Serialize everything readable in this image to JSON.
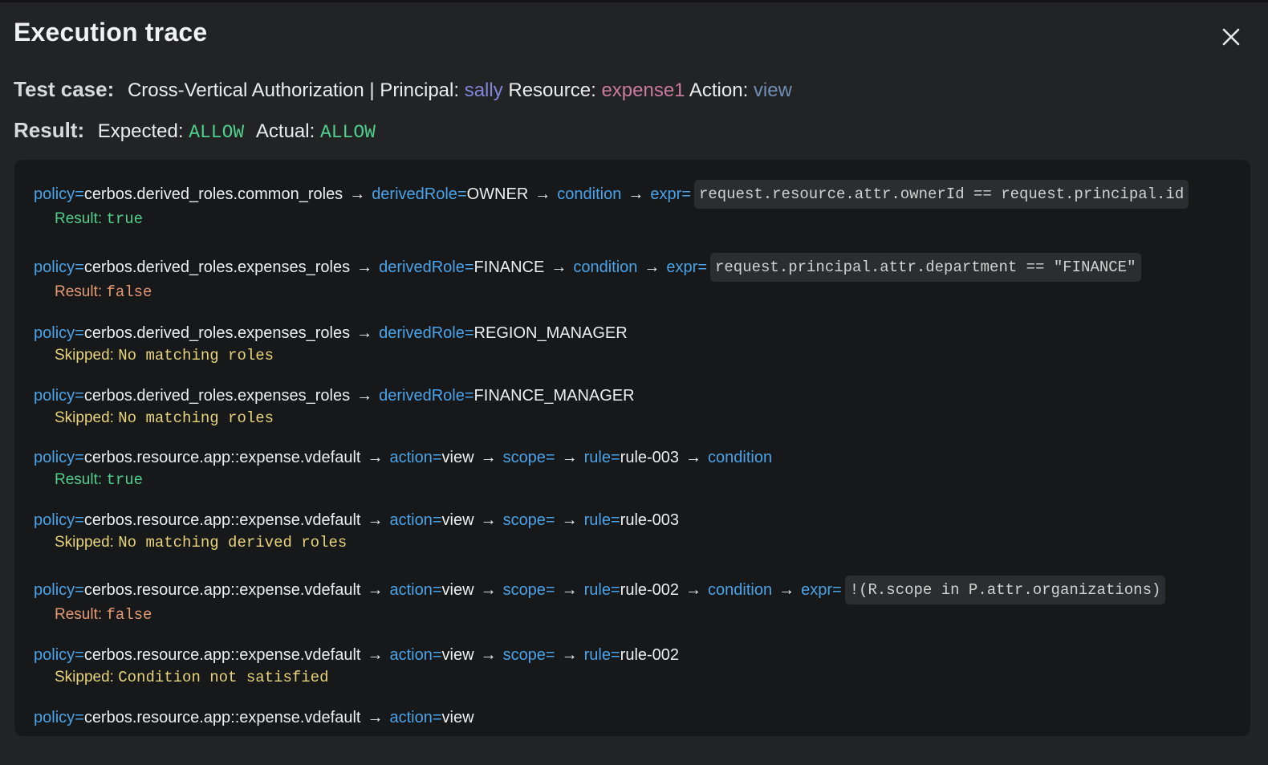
{
  "title": "Execution trace",
  "close_icon": "close-icon",
  "test_case": {
    "label": "Test case:",
    "name": "Cross-Vertical Authorization | Principal:",
    "principal": "sally",
    "resource_label": "Resource:",
    "resource": "expense1",
    "action_label": "Action:",
    "action": "view"
  },
  "result": {
    "label": "Result:",
    "expected_label": "Expected:",
    "expected": "ALLOW",
    "actual_label": "Actual:",
    "actual": "ALLOW"
  },
  "colors": {
    "background": "#222325",
    "trace_background": "#17181a",
    "key_blue": "#4aa3e8",
    "principal": "#7f86d6",
    "resource": "#c97b9d",
    "action": "#6f8fb5",
    "result_true": "#4fcf8c",
    "result_false": "#e39a73",
    "skipped": "#e6d37a"
  },
  "trace": {
    "arrow": "→",
    "entries": [
      {
        "policy_key": "policy=",
        "policy": "cerbos.derived_roles.common_roles",
        "role_key": "derivedRole=",
        "role": "OWNER",
        "condition": "condition",
        "expr_key": "expr=",
        "expr": "request.resource.attr.ownerId == request.principal.id",
        "status_label": "Result:",
        "status_value": "true"
      },
      {
        "policy_key": "policy=",
        "policy": "cerbos.derived_roles.expenses_roles",
        "role_key": "derivedRole=",
        "role": "FINANCE",
        "condition": "condition",
        "expr_key": "expr=",
        "expr": "request.principal.attr.department == \"FINANCE\"",
        "status_label": "Result:",
        "status_value": "false"
      },
      {
        "policy_key": "policy=",
        "policy": "cerbos.derived_roles.expenses_roles",
        "role_key": "derivedRole=",
        "role": "REGION_MANAGER",
        "status_label": "Skipped:",
        "status_value": "No matching roles"
      },
      {
        "policy_key": "policy=",
        "policy": "cerbos.derived_roles.expenses_roles",
        "role_key": "derivedRole=",
        "role": "FINANCE_MANAGER",
        "status_label": "Skipped:",
        "status_value": "No matching roles"
      },
      {
        "policy_key": "policy=",
        "policy": "cerbos.resource.app::expense.vdefault",
        "action_key": "action=",
        "action": "view",
        "scope_key": "scope=",
        "rule_key": "rule=",
        "rule": "rule-003",
        "condition": "condition",
        "status_label": "Result:",
        "status_value": "true"
      },
      {
        "policy_key": "policy=",
        "policy": "cerbos.resource.app::expense.vdefault",
        "action_key": "action=",
        "action": "view",
        "scope_key": "scope=",
        "rule_key": "rule=",
        "rule": "rule-003",
        "status_label": "Skipped:",
        "status_value": "No matching derived roles"
      },
      {
        "policy_key": "policy=",
        "policy": "cerbos.resource.app::expense.vdefault",
        "action_key": "action=",
        "action": "view",
        "scope_key": "scope=",
        "rule_key": "rule=",
        "rule": "rule-002",
        "condition": "condition",
        "expr_key": "expr=",
        "expr": "!(R.scope in P.attr.organizations)",
        "status_label": "Result:",
        "status_value": "false"
      },
      {
        "policy_key": "policy=",
        "policy": "cerbos.resource.app::expense.vdefault",
        "action_key": "action=",
        "action": "view",
        "scope_key": "scope=",
        "rule_key": "rule=",
        "rule": "rule-002",
        "status_label": "Skipped:",
        "status_value": "Condition not satisfied"
      },
      {
        "policy_key": "policy=",
        "policy": "cerbos.resource.app::expense.vdefault",
        "action_key": "action=",
        "action": "view"
      }
    ]
  }
}
